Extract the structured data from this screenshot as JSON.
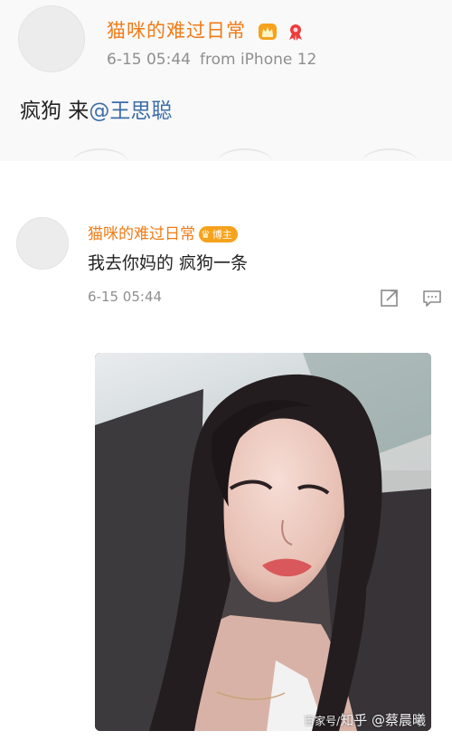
{
  "post": {
    "username": "猫咪的难过日常",
    "date": "6-15 05:44",
    "source": "from iPhone 12",
    "text_prefix": "疯狗 来",
    "mention": "@王思聪"
  },
  "comment": {
    "username": "猫咪的难过日常",
    "badge": "博主",
    "text": "我去你妈的 疯狗一条",
    "date": "6-15 05:44"
  },
  "image": {
    "watermark_small": "百家号/",
    "watermark_large": "知乎 @",
    "watermark_end": "蔡晨曦"
  },
  "colors": {
    "username": "#f07b16",
    "mention": "#3d6da8",
    "meta": "#8f8f8f"
  }
}
